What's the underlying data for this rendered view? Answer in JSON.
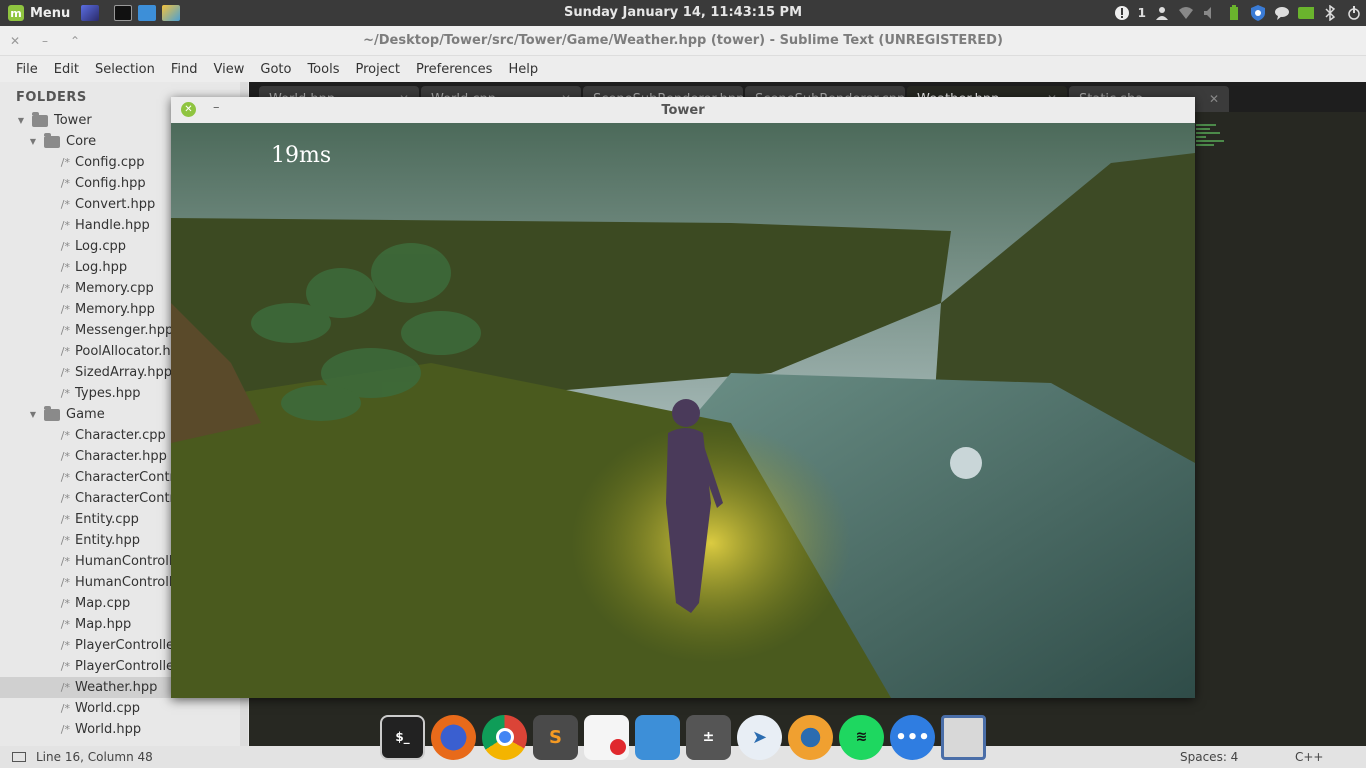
{
  "top_panel": {
    "menu_label": "Menu",
    "clock": "Sunday January 14, 11:43:15 PM",
    "notification_count": "1"
  },
  "sublime": {
    "title": "~/Desktop/Tower/src/Tower/Game/Weather.hpp (tower) - Sublime Text (UNREGISTERED)",
    "menu": [
      "File",
      "Edit",
      "Selection",
      "Find",
      "View",
      "Goto",
      "Tools",
      "Project",
      "Preferences",
      "Help"
    ],
    "sidebar": {
      "title": "FOLDERS",
      "root": "Tower",
      "core_folder": "Core",
      "core_files": [
        "Config.cpp",
        "Config.hpp",
        "Convert.hpp",
        "Handle.hpp",
        "Log.cpp",
        "Log.hpp",
        "Memory.cpp",
        "Memory.hpp",
        "Messenger.hpp",
        "PoolAllocator.hp",
        "SizedArray.hpp",
        "Types.hpp"
      ],
      "game_folder": "Game",
      "game_files": [
        "Character.cpp",
        "Character.hpp",
        "CharacterContro",
        "CharacterContro",
        "Entity.cpp",
        "Entity.hpp",
        "HumanControlle",
        "HumanControlle",
        "Map.cpp",
        "Map.hpp",
        "PlayerController.",
        "PlayerController.",
        "Weather.hpp",
        "World.cpp",
        "World.hpp"
      ],
      "selected_file": "Weather.hpp"
    },
    "tabs": [
      {
        "label": "World.hpp",
        "active": false
      },
      {
        "label": "World.cpp",
        "active": false
      },
      {
        "label": "SceneSubRenderer.hpp",
        "active": false
      },
      {
        "label": "SceneSubRenderer.cpp",
        "active": false
      },
      {
        "label": "Weather.hpp",
        "active": true
      },
      {
        "label": "Static.sha",
        "active": false
      }
    ],
    "status": {
      "position": "Line 16, Column 48",
      "spaces": "Spaces: 4",
      "syntax": "C++"
    }
  },
  "game_window": {
    "title": "Tower",
    "frame_time": "19ms"
  },
  "dock": {
    "items": [
      "terminal-icon",
      "firefox-icon",
      "chrome-icon",
      "sublime-icon",
      "text-editor-icon",
      "files-icon",
      "calculator-icon",
      "web-browser-icon",
      "blender-icon",
      "spotify-icon",
      "chat-icon",
      "window-icon"
    ]
  },
  "colors": {
    "mint_green": "#8fc440",
    "editor_bg": "#272822",
    "panel_bg": "#3a3a3a"
  }
}
